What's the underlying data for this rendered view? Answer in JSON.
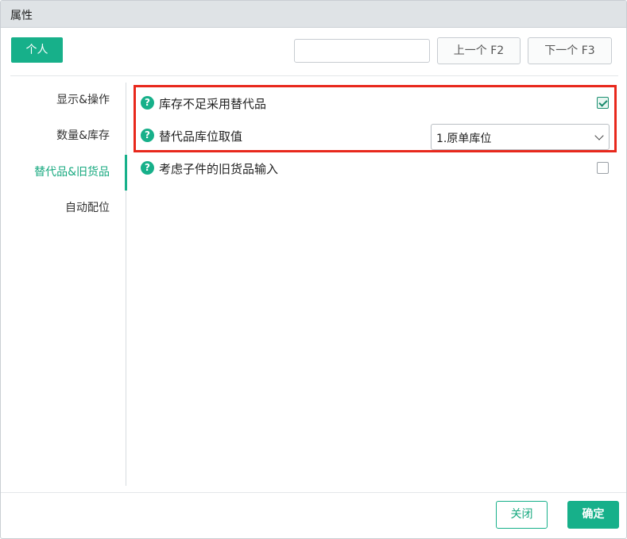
{
  "window": {
    "title": "属性"
  },
  "toolbar": {
    "personal_label": "个人",
    "search_value": "",
    "prev_label": "上一个 F2",
    "next_label": "下一个 F3"
  },
  "sidebar": {
    "items": [
      {
        "label": "显示&操作",
        "active": false
      },
      {
        "label": "数量&库存",
        "active": false
      },
      {
        "label": "替代品&旧货品",
        "active": true
      },
      {
        "label": "自动配位",
        "active": false
      }
    ]
  },
  "options": [
    {
      "label": "库存不足采用替代品",
      "type": "checkbox",
      "checked": true
    },
    {
      "label": "替代品库位取值",
      "type": "select",
      "value": "1.原单库位"
    },
    {
      "label": "考虑子件的旧货品输入",
      "type": "checkbox",
      "checked": false
    }
  ],
  "icons": {
    "help": "help-circle-icon",
    "help_glyph": "?",
    "dropdown": "chevron-down-icon"
  },
  "footer": {
    "close_label": "关闭",
    "ok_label": "确定"
  },
  "colors": {
    "accent": "#17b08a",
    "highlight": "#e8281c",
    "titlebar": "#dfe3e6"
  }
}
